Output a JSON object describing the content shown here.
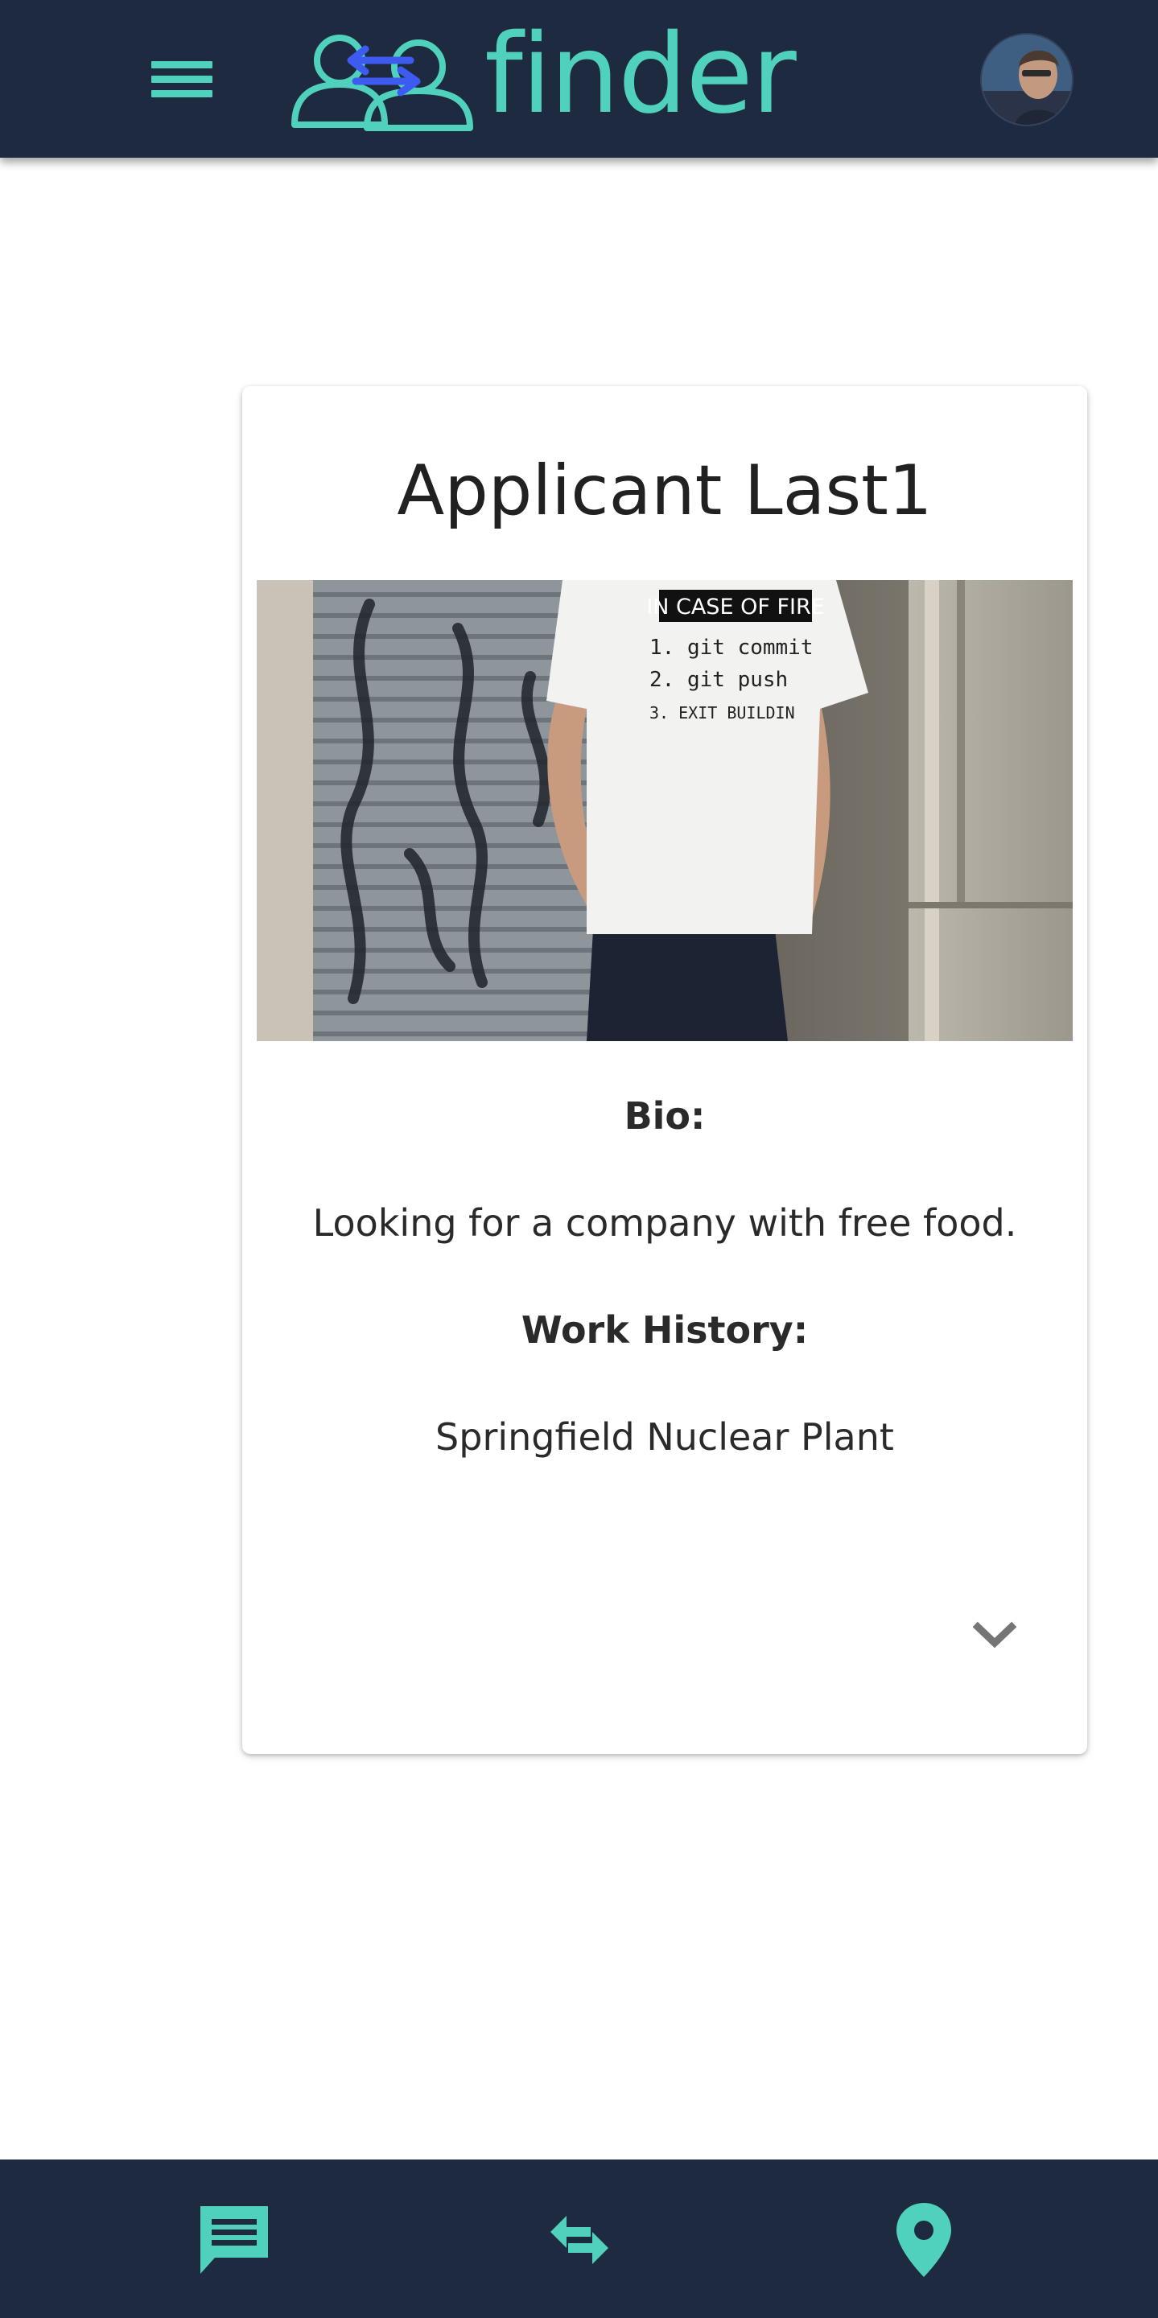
{
  "app": {
    "name": "finder",
    "accent_color": "#4fd1bd",
    "bar_color": "#1e2a40"
  },
  "header": {
    "menu_icon": "hamburger-menu-icon",
    "logo_icon": "people-swap-logo-icon",
    "logo_text": "finder",
    "avatar": "user-avatar"
  },
  "card": {
    "title": "Applicant Last1",
    "photo_shirt_text": {
      "heading": "IN CASE OF FIRE",
      "line1": "1. git commit",
      "line2": "2. git push",
      "line3": "3. EXIT BUILDIN"
    },
    "bio_label": "Bio:",
    "bio_text": "Looking for a company with free food.",
    "work_label": "Work History:",
    "work_text": "Springfield Nuclear Plant",
    "expand_icon": "chevron-down-icon"
  },
  "bottom_nav": {
    "items": [
      {
        "icon": "chat-icon"
      },
      {
        "icon": "swap-arrows-icon"
      },
      {
        "icon": "map-pin-icon"
      }
    ]
  }
}
